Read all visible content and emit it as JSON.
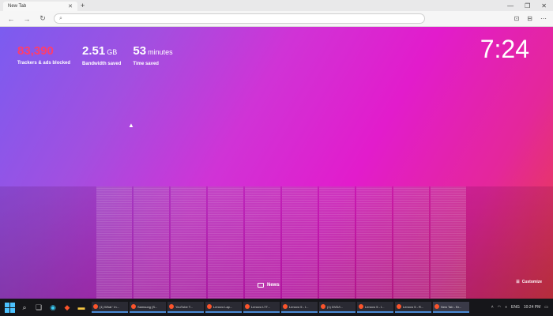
{
  "browser": {
    "tab_title": "New Tab",
    "tab_close": "✕",
    "new_tab": "+",
    "window_controls": [
      "—",
      "❐",
      "✕"
    ],
    "address_value": "",
    "nav": {
      "back": "←",
      "forward": "→",
      "reload": "↻"
    },
    "toolbar_icons": [
      "⊡",
      "⊟",
      "⋯"
    ]
  },
  "stats": [
    {
      "value": "83,390",
      "unit": "",
      "label": "Trackers & ads blocked",
      "color": "#ff3d6b"
    },
    {
      "value": "2.51",
      "unit": "GB",
      "label": "Bandwidth saved",
      "color": "#ffffff"
    },
    {
      "value": "53",
      "unit": "minutes",
      "label": "Time saved",
      "color": "#ffffff"
    }
  ],
  "clock": "7:24",
  "news_label": "News",
  "customize_label": "Customize",
  "taskbar": {
    "apps": [
      "(1) What ' In...",
      "Samsung (S...",
      "YouTube T...",
      "Lenovo Lap...",
      "Lenovo LTT...",
      "Lenovo 5 - I...",
      "(1) DVD/I...",
      "Lenovo 5 - I...",
      "Lenovo 5 - R...",
      "New Tab - Br..."
    ],
    "tray_lang": "ENG",
    "tray_time": "10:24 PM"
  },
  "colors": {
    "accent_red": "#ff3d6b",
    "taskbar": "#16161a",
    "brave_orange": "#fb542b"
  }
}
